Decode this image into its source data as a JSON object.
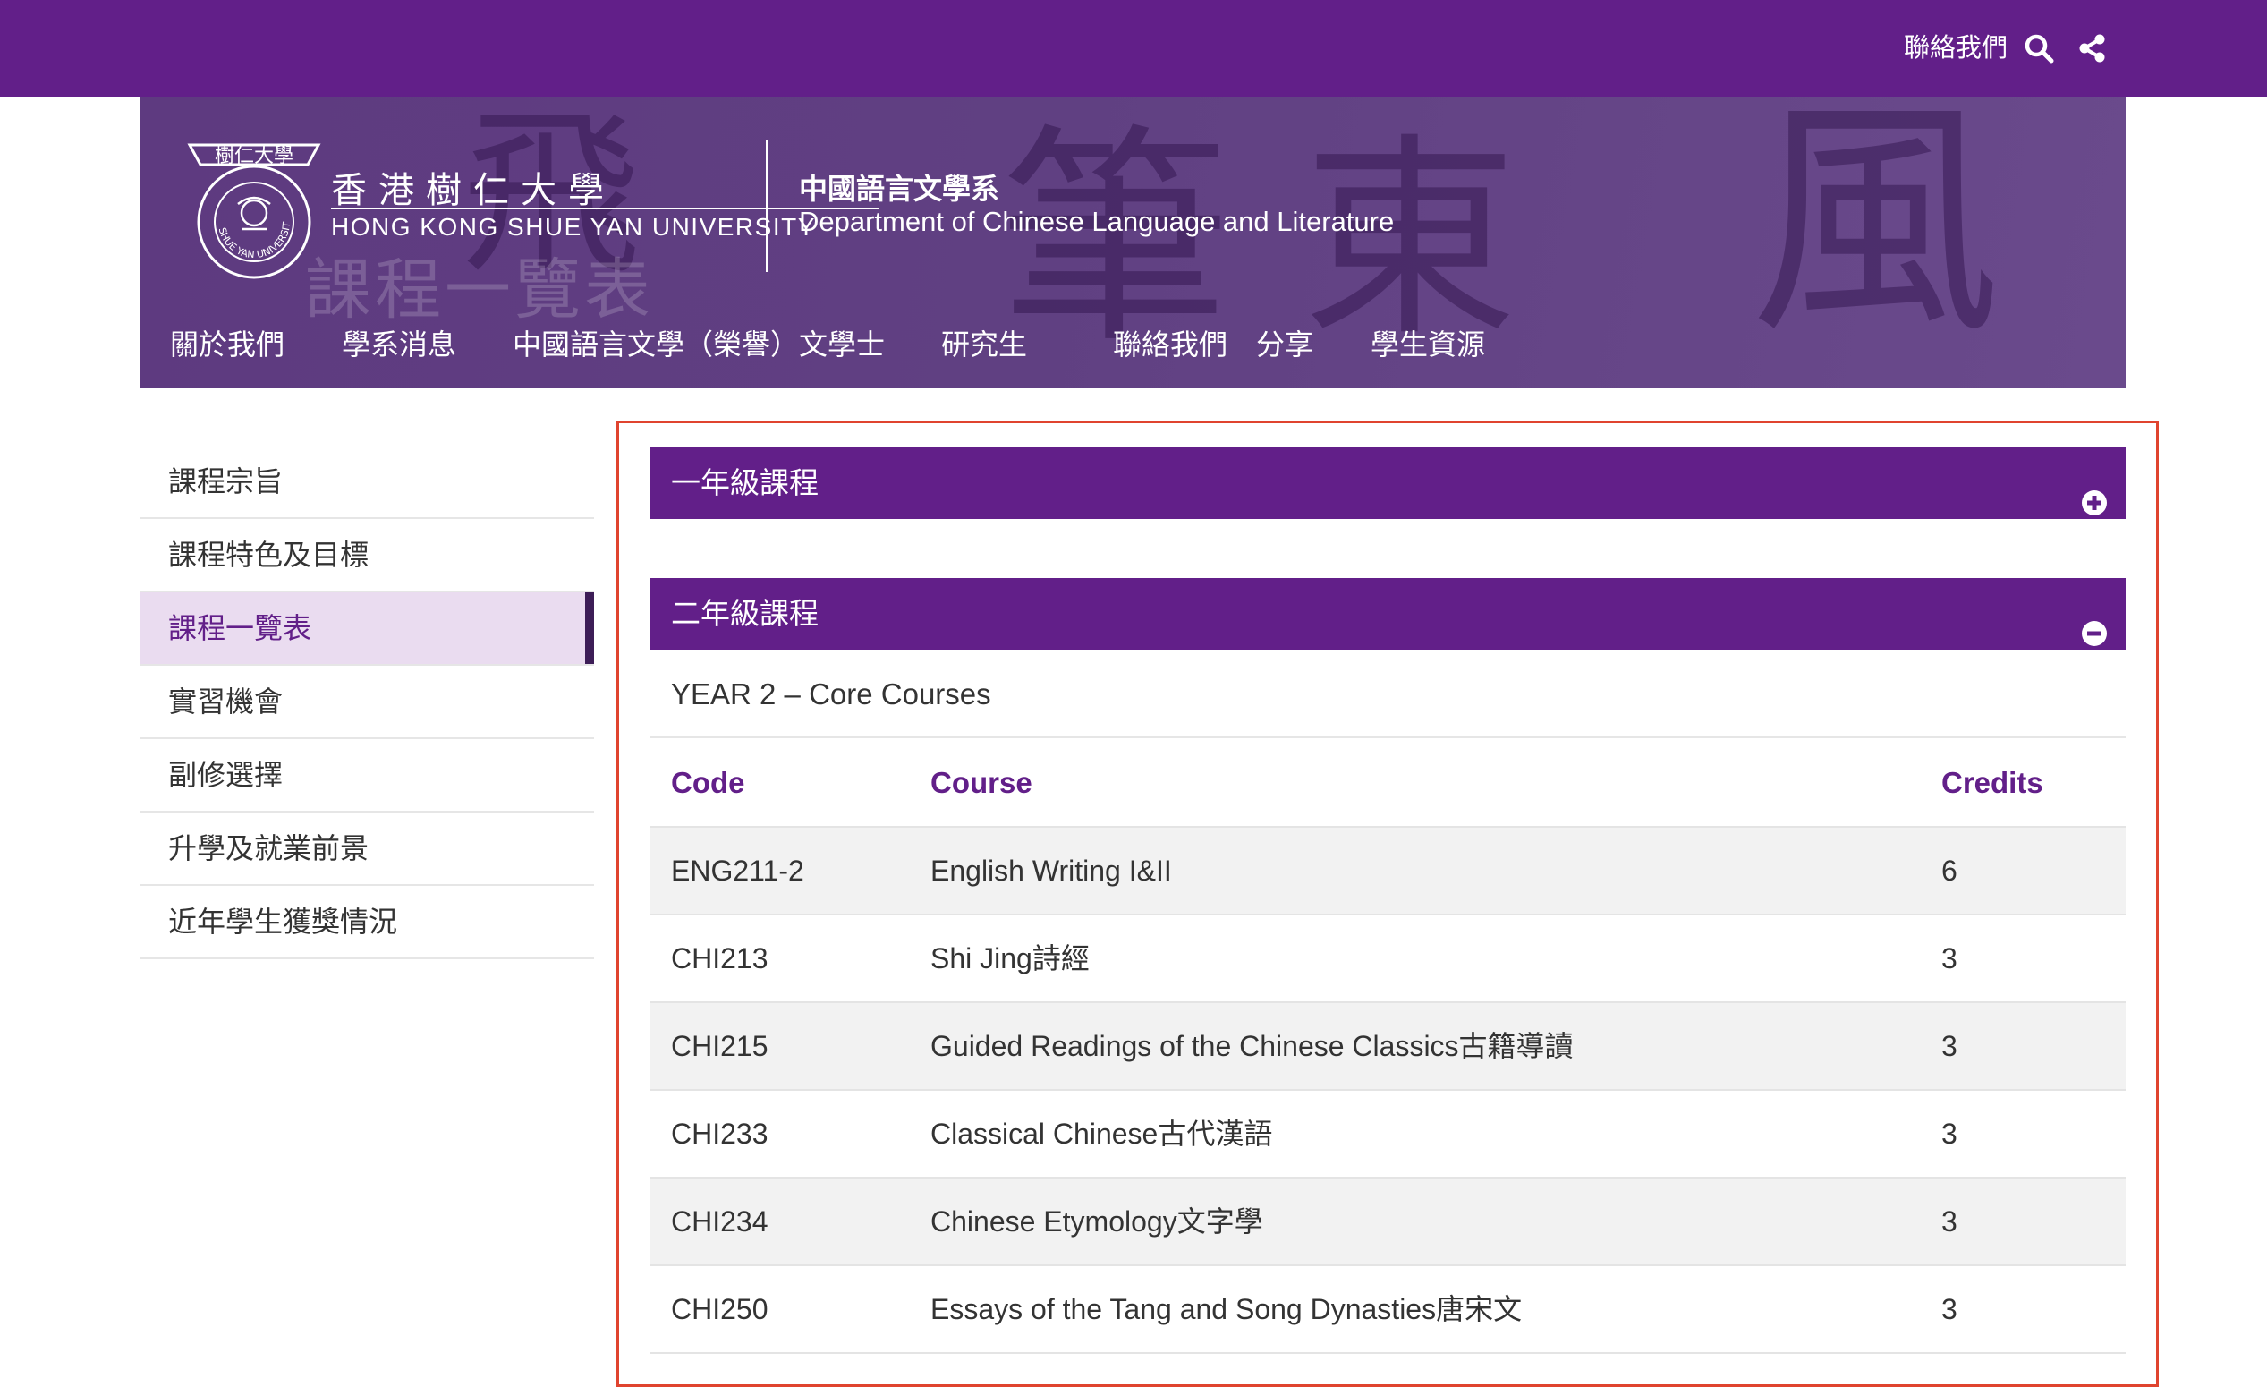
{
  "topbar": {
    "contact_label": "聯絡我們",
    "icons": [
      "search-icon",
      "share-icon"
    ]
  },
  "header": {
    "logo_text": "樹仁大學",
    "logo_ring_text": "SHUE YAN UNIVERSITY",
    "university_zh": "香港樹仁大學",
    "university_en": "HONG KONG SHUE YAN UNIVERSITY",
    "department_zh": "中國語言文學系",
    "department_en": "Department of Chinese Language and Literature",
    "page_heading": "課程一覽表"
  },
  "nav": {
    "items": [
      "關於我們",
      "學系消息",
      "中國語言文學（榮譽）文學士",
      "研究生",
      "聯絡我們",
      "分享",
      "學生資源"
    ]
  },
  "sidebar": {
    "items": [
      {
        "label": "課程宗旨"
      },
      {
        "label": "課程特色及目標"
      },
      {
        "label": "課程一覽表",
        "active": true
      },
      {
        "label": "實習機會"
      },
      {
        "label": "副修選擇"
      },
      {
        "label": "升學及就業前景"
      },
      {
        "label": "近年學生獲獎情況"
      }
    ]
  },
  "accordion": {
    "year1": {
      "label": "一年級課程",
      "expanded": false,
      "icon": "plus-circle-icon"
    },
    "year2": {
      "label": "二年級課程",
      "expanded": true,
      "icon": "minus-circle-icon"
    }
  },
  "year2": {
    "title": "YEAR 2 – Core Courses",
    "columns": {
      "code": "Code",
      "course": "Course",
      "credits": "Credits"
    },
    "rows": [
      {
        "code": "ENG211-2",
        "course": "English Writing I&II",
        "credits": "6"
      },
      {
        "code": "CHI213",
        "course": "Shi Jing詩經",
        "credits": "3"
      },
      {
        "code": "CHI215",
        "course": "Guided Readings of the Chinese Classics古籍導讀",
        "credits": "3"
      },
      {
        "code": "CHI233",
        "course": "Classical Chinese古代漢語",
        "credits": "3"
      },
      {
        "code": "CHI234",
        "course": "Chinese Etymology文字學",
        "credits": "3"
      },
      {
        "code": "CHI250",
        "course": "Essays of the Tang and Song Dynasties唐宋文",
        "credits": "3"
      }
    ]
  },
  "colors": {
    "brand_purple": "#621f89",
    "hero_purple": "#5e3a80",
    "active_bg": "#eadcf0",
    "frame_red": "#e0442f"
  }
}
